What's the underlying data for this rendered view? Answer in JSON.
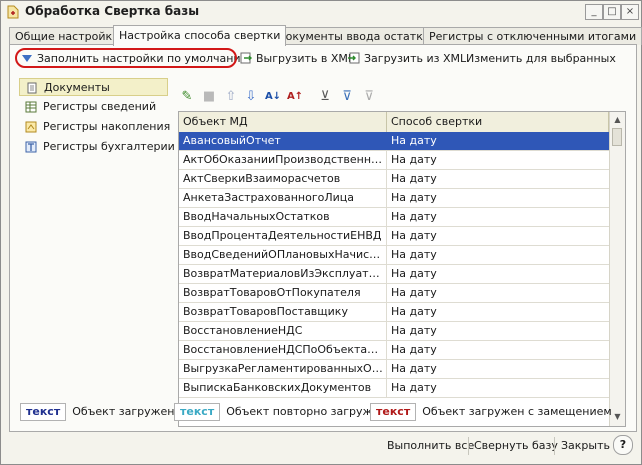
{
  "window": {
    "title": "Обработка  Свертка базы",
    "controls": [
      "_",
      "□",
      "×"
    ]
  },
  "tabs": [
    {
      "label": "Общие настройки"
    },
    {
      "label": "Настройка способа свертки"
    },
    {
      "label": "Документы ввода остатков"
    },
    {
      "label": "Регистры с отключенными итогами"
    }
  ],
  "commands": {
    "fill_defaults": "Заполнить настройки по умолчанию",
    "export_xml": "Выгрузить в XML",
    "import_xml": "Загрузить из XML",
    "change_selected": "Изменить для выбранных"
  },
  "object_types": [
    {
      "label": "Документы"
    },
    {
      "label": "Регистры сведений"
    },
    {
      "label": "Регистры накопления"
    },
    {
      "label": "Регистры бухгалтерии"
    }
  ],
  "table": {
    "columns": [
      "Объект МД",
      "Способ свертки"
    ],
    "rows": [
      {
        "object": "АвансовыйОтчет",
        "method": "На дату"
      },
      {
        "object": "АктОбОказанииПроизводственныхУслуг",
        "method": "На дату"
      },
      {
        "object": "АктСверкиВзаиморасчетов",
        "method": "На дату"
      },
      {
        "object": "АнкетаЗастрахованногоЛица",
        "method": "На дату"
      },
      {
        "object": "ВводНачальныхОстатков",
        "method": "На дату"
      },
      {
        "object": "ВводПроцентаДеятельностиЕНВД",
        "method": "На дату"
      },
      {
        "object": "ВводСведенийОПлановыхНачислениях",
        "method": "На дату"
      },
      {
        "object": "ВозвратМатериаловИзЭксплуатации",
        "method": "На дату"
      },
      {
        "object": "ВозвратТоваровОтПокупателя",
        "method": "На дату"
      },
      {
        "object": "ВозвратТоваровПоставщику",
        "method": "На дату"
      },
      {
        "object": "ВосстановлениеНДС",
        "method": "На дату"
      },
      {
        "object": "ВосстановлениеНДСПоОбъектамНедвижимости",
        "method": "На дату"
      },
      {
        "object": "ВыгрузкаРегламентированныхОтчетов",
        "method": "На дату"
      },
      {
        "object": "ВыпискаБанковскихДокументов",
        "method": "На дату"
      }
    ]
  },
  "legend": [
    {
      "sample": "текст",
      "label": "Объект загружен",
      "color": "#1f2f8f"
    },
    {
      "sample": "текст",
      "label": "Объект повторно загружен",
      "color": "#3aa9c4"
    },
    {
      "sample": "текст",
      "label": "Объект загружен с замещением",
      "color": "#b01818"
    }
  ],
  "footer": {
    "run_all": "Выполнить все",
    "collapse": "Свернуть базу",
    "close": "Закрыть",
    "help": "?"
  },
  "colors": {
    "selection": "#2f57b7",
    "annotation_oval": "#d21818",
    "selected_type_bg": "#f3f0c9"
  }
}
